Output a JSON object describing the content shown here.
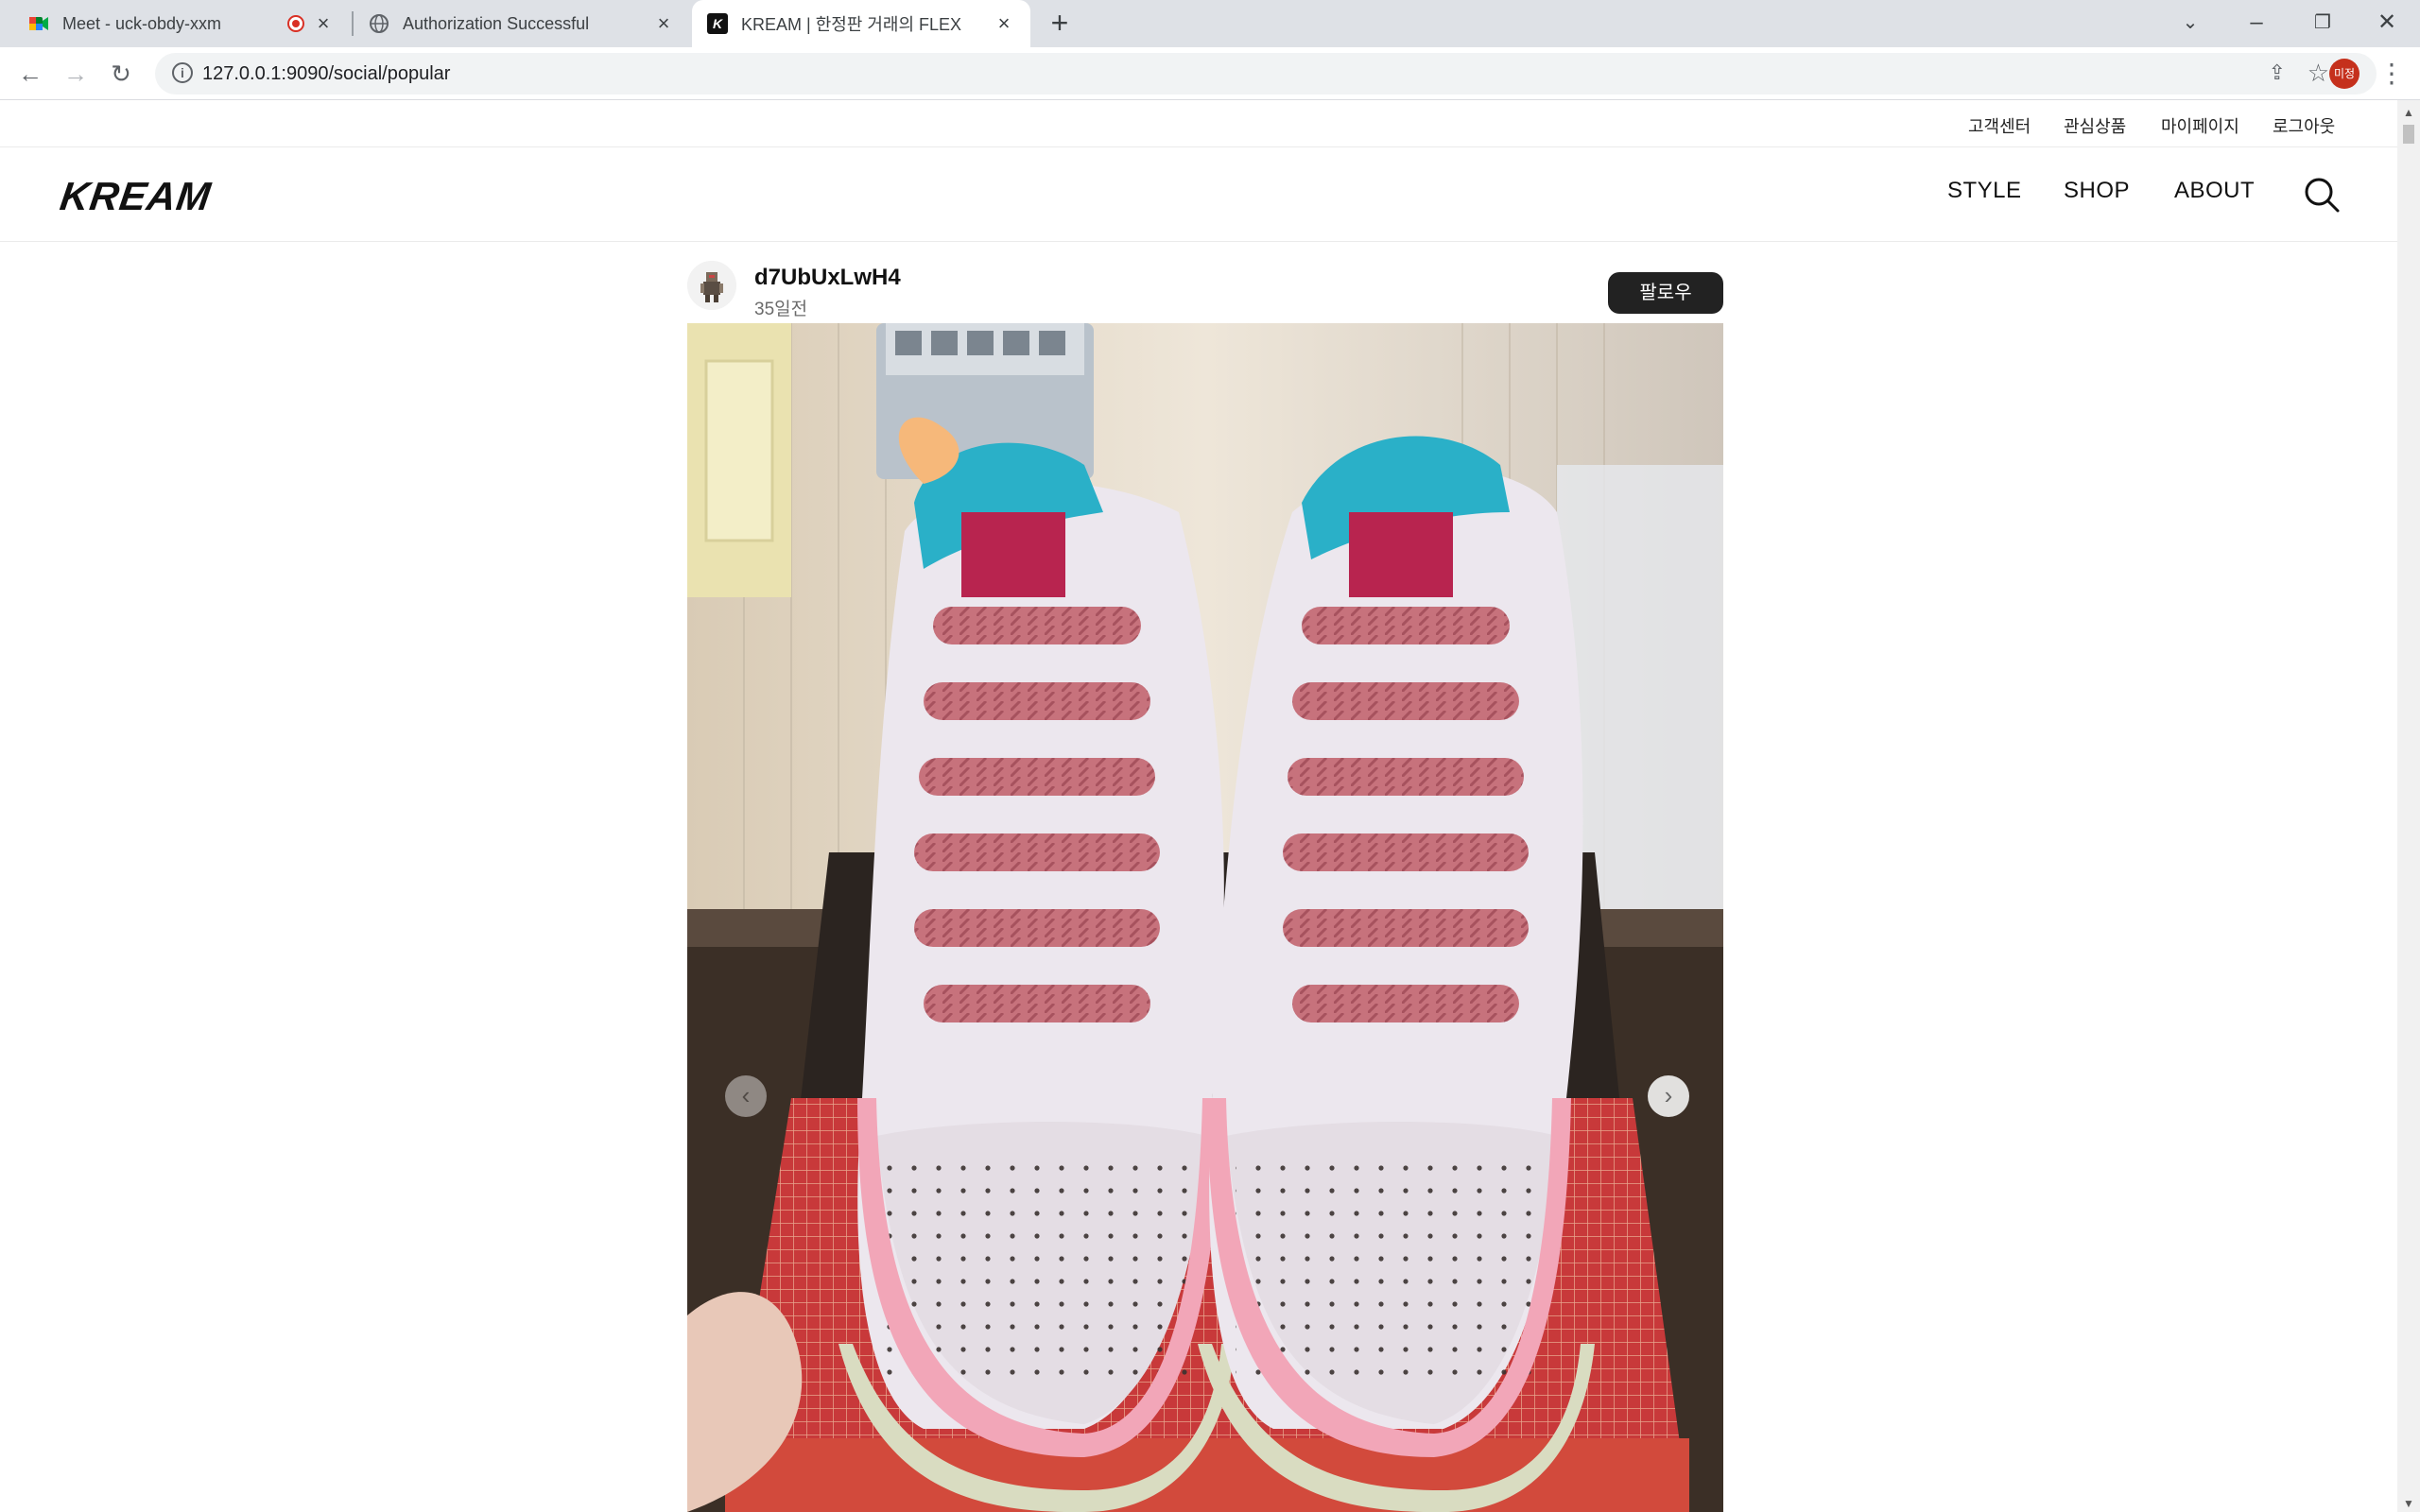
{
  "browser": {
    "tabs": [
      {
        "title": "Meet - uck-obdy-xxm",
        "icon": "google-meet-icon",
        "recording": true
      },
      {
        "title": "Authorization Successful",
        "icon": "globe-icon"
      },
      {
        "title": "KREAM | 한정판 거래의 FLEX",
        "icon": "kream-logo-icon",
        "active": true
      }
    ],
    "url": "127.0.0.1:9090/social/popular",
    "profile_label": "미정"
  },
  "util_links": [
    "고객센터",
    "관심상품",
    "마이페이지",
    "로그아웃"
  ],
  "header": {
    "logo": "KREAM",
    "nav": [
      "STYLE",
      "SHOP",
      "ABOUT"
    ]
  },
  "post": {
    "username": "d7UbUxLwH4",
    "time": "35일전",
    "follow_label": "팔로우"
  },
  "colors": {
    "follow_button": "#222222",
    "profile_badge": "#c5301c",
    "tab_strip": "#dee1e6"
  }
}
